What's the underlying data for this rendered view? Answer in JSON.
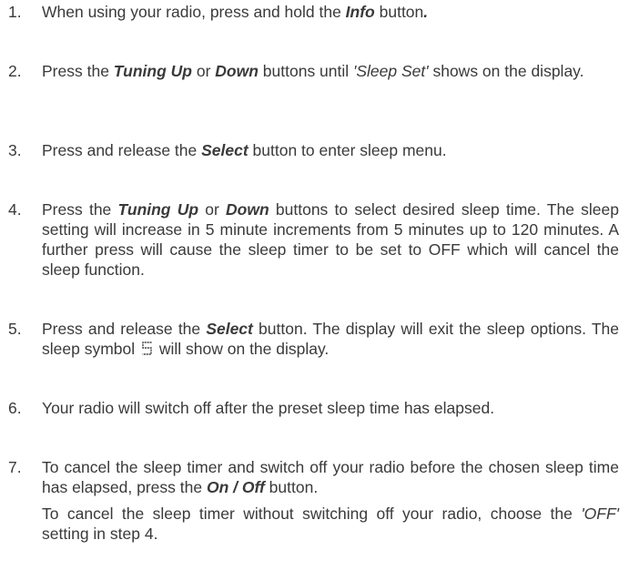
{
  "steps": [
    {
      "number": "1.",
      "segments": [
        {
          "t": "When using your radio, press and hold the "
        },
        {
          "t": "Info",
          "s": "bi"
        },
        {
          "t": " button"
        },
        {
          "t": ".",
          "s": "bi"
        }
      ]
    },
    {
      "number": "2.",
      "segments": [
        {
          "t": "Press the "
        },
        {
          "t": "Tuning Up",
          "s": "bi"
        },
        {
          "t": " or "
        },
        {
          "t": "Down",
          "s": "bi"
        },
        {
          "t": " buttons until "
        },
        {
          "t": "'Sleep Set'",
          "s": "it"
        },
        {
          "t": " shows on the display."
        }
      ]
    },
    {
      "number": "3.",
      "segments": [
        {
          "t": "Press and release the "
        },
        {
          "t": "Select",
          "s": "bi"
        },
        {
          "t": " button to enter sleep menu."
        }
      ]
    },
    {
      "number": "4.",
      "segments": [
        {
          "t": "Press the "
        },
        {
          "t": "Tuning Up",
          "s": "bi"
        },
        {
          "t": " or "
        },
        {
          "t": "Down",
          "s": "bi"
        },
        {
          "t": " buttons to select desired sleep time. The sleep setting will increase in 5 minute increments from 5 minutes up to 120 minutes. A further press will cause the sleep timer to be set to OFF which will cancel the sleep function."
        }
      ]
    },
    {
      "number": "5.",
      "segments": [
        {
          "t": "Press and release the "
        },
        {
          "t": "Select",
          "s": "bi"
        },
        {
          "t": " button. The display will exit the sleep options. The sleep symbol "
        },
        {
          "icon": "sleep-symbol-icon"
        },
        {
          "t": " will show on the display."
        }
      ]
    },
    {
      "number": "6.",
      "segments": [
        {
          "t": "Your radio will switch off after the preset sleep time has elapsed."
        }
      ]
    },
    {
      "number": "7.",
      "segments": [
        {
          "t": "To cancel the sleep timer and switch off your radio before the chosen sleep time has elapsed, press the "
        },
        {
          "t": "On / Off",
          "s": "bi"
        },
        {
          "t": " button."
        }
      ],
      "extra": [
        {
          "t": "To cancel the sleep timer without switching off your radio, choose the "
        },
        {
          "t": "'OFF'",
          "s": "it"
        },
        {
          "t": " setting in step 4."
        }
      ]
    }
  ]
}
